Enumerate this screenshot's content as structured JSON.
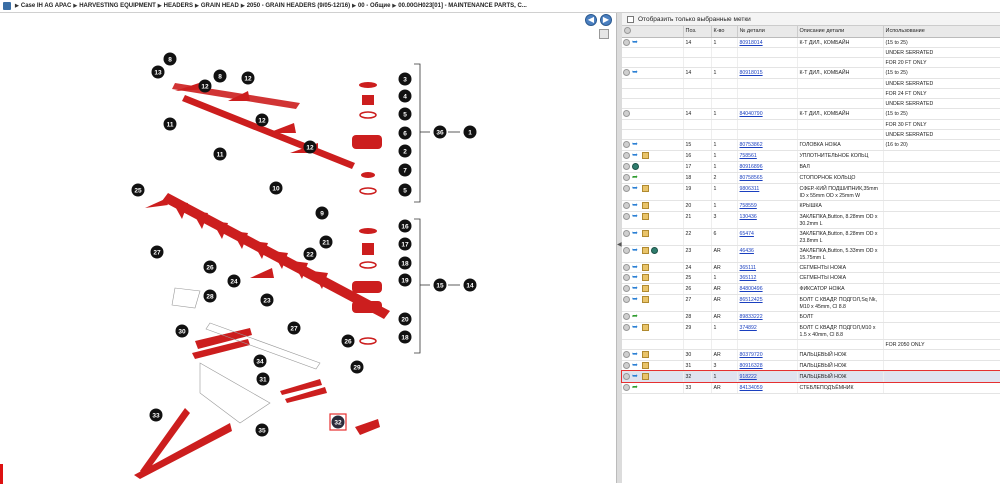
{
  "breadcrumb": [
    "Case IH AG APAC",
    "HARVESTING EQUIPMENT",
    "HEADERS",
    "GRAIN HEAD",
    "2050 - GRAIN HEADERS (9/05-12/16)",
    "00 - Общие",
    "00.00GH023[01] - MAINTENANCE PARTS, C..."
  ],
  "nav": {
    "back": "◀",
    "forward": "▶"
  },
  "filter_label": "Отобразить только выбранные метки",
  "splitter_glyph": "◀",
  "table": {
    "headers": [
      "Поз.",
      "К-во",
      "№ детали",
      "Описание детали",
      "Использование"
    ],
    "rows": [
      {
        "pos": "14",
        "qty": "1",
        "part": "80918014",
        "desc": "К-Т ДИЛ., КОМБАЙН",
        "usage": "(15 to 25)",
        "icons": [
          "circ",
          "arr"
        ]
      },
      {
        "pos": "",
        "qty": "",
        "part": "",
        "desc": "",
        "usage": "UNDER SERRATED",
        "icons": []
      },
      {
        "pos": "",
        "qty": "",
        "part": "",
        "desc": "",
        "usage": "FOR 20 FT ONLY",
        "icons": []
      },
      {
        "pos": "14",
        "qty": "1",
        "part": "80918015",
        "desc": "К-Т ДИЛ., КОМБАЙН",
        "usage": "(15 to 25)",
        "icons": [
          "circ",
          "arr"
        ]
      },
      {
        "pos": "",
        "qty": "",
        "part": "",
        "desc": "",
        "usage": "UNDER SERRATED",
        "icons": []
      },
      {
        "pos": "",
        "qty": "",
        "part": "",
        "desc": "",
        "usage": "FOR 24 FT ONLY",
        "icons": []
      },
      {
        "pos": "",
        "qty": "",
        "part": "",
        "desc": "",
        "usage": "UNDER SERRATED",
        "icons": []
      },
      {
        "pos": "14",
        "qty": "1",
        "part": "84040790",
        "desc": "К-Т ДИЛ., КОМБАЙН",
        "usage": "(15 to 25)",
        "icons": [
          "circ"
        ]
      },
      {
        "pos": "",
        "qty": "",
        "part": "",
        "desc": "",
        "usage": "FOR 30 FT ONLY",
        "icons": []
      },
      {
        "pos": "",
        "qty": "",
        "part": "",
        "desc": "",
        "usage": "UNDER SERRATED",
        "icons": []
      },
      {
        "pos": "15",
        "qty": "1",
        "part": "80753862",
        "desc": "ГОЛОВКА НОЖА",
        "usage": "(16 to 20)",
        "icons": [
          "circ",
          "arr"
        ]
      },
      {
        "pos": "16",
        "qty": "1",
        "part": "758561",
        "desc": "УПЛОТНИТЕЛЬНОЕ КОЛЬЦ",
        "usage": "",
        "icons": [
          "circ",
          "arr",
          "box"
        ]
      },
      {
        "pos": "17",
        "qty": "1",
        "part": "80916896",
        "desc": "ВАЛ",
        "usage": "",
        "icons": [
          "circ",
          "gear"
        ]
      },
      {
        "pos": "18",
        "qty": "2",
        "part": "80758565",
        "desc": "СТОПОРНОЕ КОЛЬЦО",
        "usage": "",
        "icons": [
          "circ",
          "green"
        ]
      },
      {
        "pos": "19",
        "qty": "1",
        "part": "9806311",
        "desc": "СФЕР.-КИЙ ПОДШИПНИК,35mm ID x 55mm OD x 25mm W",
        "usage": "",
        "icons": [
          "circ",
          "arr",
          "box"
        ]
      },
      {
        "pos": "20",
        "qty": "1",
        "part": "758559",
        "desc": "КРЫШКА",
        "usage": "",
        "icons": [
          "circ",
          "arr",
          "box"
        ]
      },
      {
        "pos": "21",
        "qty": "3",
        "part": "130436",
        "desc": "ЗАКЛЕПКА,Button, 8.28mm OD x 30.2mm L",
        "usage": "",
        "icons": [
          "circ",
          "arr",
          "box"
        ]
      },
      {
        "pos": "22",
        "qty": "6",
        "part": "65474",
        "desc": "ЗАКЛЕПКА,Button, 8.28mm OD x 23.8mm L",
        "usage": "",
        "icons": [
          "circ",
          "arr",
          "box"
        ]
      },
      {
        "pos": "23",
        "qty": "AR",
        "part": "46436",
        "desc": "ЗАКЛЕПКА,Button, 5.33mm OD x 15.75mm L",
        "usage": "",
        "icons": [
          "circ",
          "arr",
          "box",
          "gear"
        ]
      },
      {
        "pos": "24",
        "qty": "AR",
        "part": "365111",
        "desc": "СЕГМЕНТЫ НОЖА",
        "usage": "",
        "icons": [
          "circ",
          "arr",
          "box"
        ]
      },
      {
        "pos": "25",
        "qty": "1",
        "part": "365112",
        "desc": "СЕГМЕНТЫ НОЖА",
        "usage": "",
        "icons": [
          "circ",
          "arr",
          "box"
        ]
      },
      {
        "pos": "26",
        "qty": "AR",
        "part": "84800496",
        "desc": "ФИКСАТОР НОЖА",
        "usage": "",
        "icons": [
          "circ",
          "arr",
          "box"
        ]
      },
      {
        "pos": "27",
        "qty": "AR",
        "part": "86512425",
        "desc": "БОЛТ С КВАДР. ПОДГОЛ,Sq Nk, M10 x 45mm, Cl 8.8",
        "usage": "",
        "icons": [
          "circ",
          "arr",
          "box"
        ]
      },
      {
        "pos": "28",
        "qty": "AR",
        "part": "89833222",
        "desc": "БОЛТ",
        "usage": "",
        "icons": [
          "circ",
          "green"
        ]
      },
      {
        "pos": "29",
        "qty": "1",
        "part": "374892",
        "desc": "БОЛТ С КВАДР. ПОДГОЛ,M10 x 1.5 x 40mm, Cl 8.8",
        "usage": "",
        "icons": [
          "circ",
          "arr",
          "box"
        ]
      },
      {
        "pos": "",
        "qty": "",
        "part": "",
        "desc": "",
        "usage": "FOR 2050 ONLY",
        "icons": []
      },
      {
        "pos": "30",
        "qty": "AR",
        "part": "80379720",
        "desc": "ПАЛЬЦЕВЫЙ НОЖ",
        "usage": "",
        "icons": [
          "circ",
          "arr",
          "box"
        ]
      },
      {
        "pos": "31",
        "qty": "3",
        "part": "80916328",
        "desc": "ПАЛЬЦЕВЫЙ НОЖ",
        "usage": "",
        "icons": [
          "circ",
          "arr",
          "box"
        ]
      },
      {
        "pos": "32",
        "qty": "1",
        "part": "918222",
        "desc": "ПАЛЬЦЕВЫЙ НОЖ",
        "usage": "",
        "icons": [
          "circ",
          "arr",
          "box"
        ],
        "selected": true
      },
      {
        "pos": "33",
        "qty": "AR",
        "part": "84134059",
        "desc": "СТЕБЛЕПОДЪЁМНИК",
        "usage": "",
        "icons": [
          "circ",
          "green"
        ]
      }
    ]
  },
  "callouts": [
    "8",
    "13",
    "12",
    "8",
    "12",
    "11",
    "12",
    "12",
    "11",
    "10",
    "9",
    "25",
    "27",
    "26",
    "24",
    "21",
    "22",
    "23",
    "28",
    "30",
    "27",
    "26",
    "34",
    "31",
    "29",
    "33",
    "35",
    "32",
    "3",
    "4",
    "5",
    "6",
    "2",
    "7",
    "5",
    "36",
    "1",
    "16",
    "17",
    "18",
    "19",
    "20",
    "18",
    "15",
    "14"
  ],
  "selected_callout": "32",
  "colors": {
    "part_red": "#cc1e1e",
    "selected_border": "#e53030",
    "link_blue": "#1a3fbf"
  }
}
